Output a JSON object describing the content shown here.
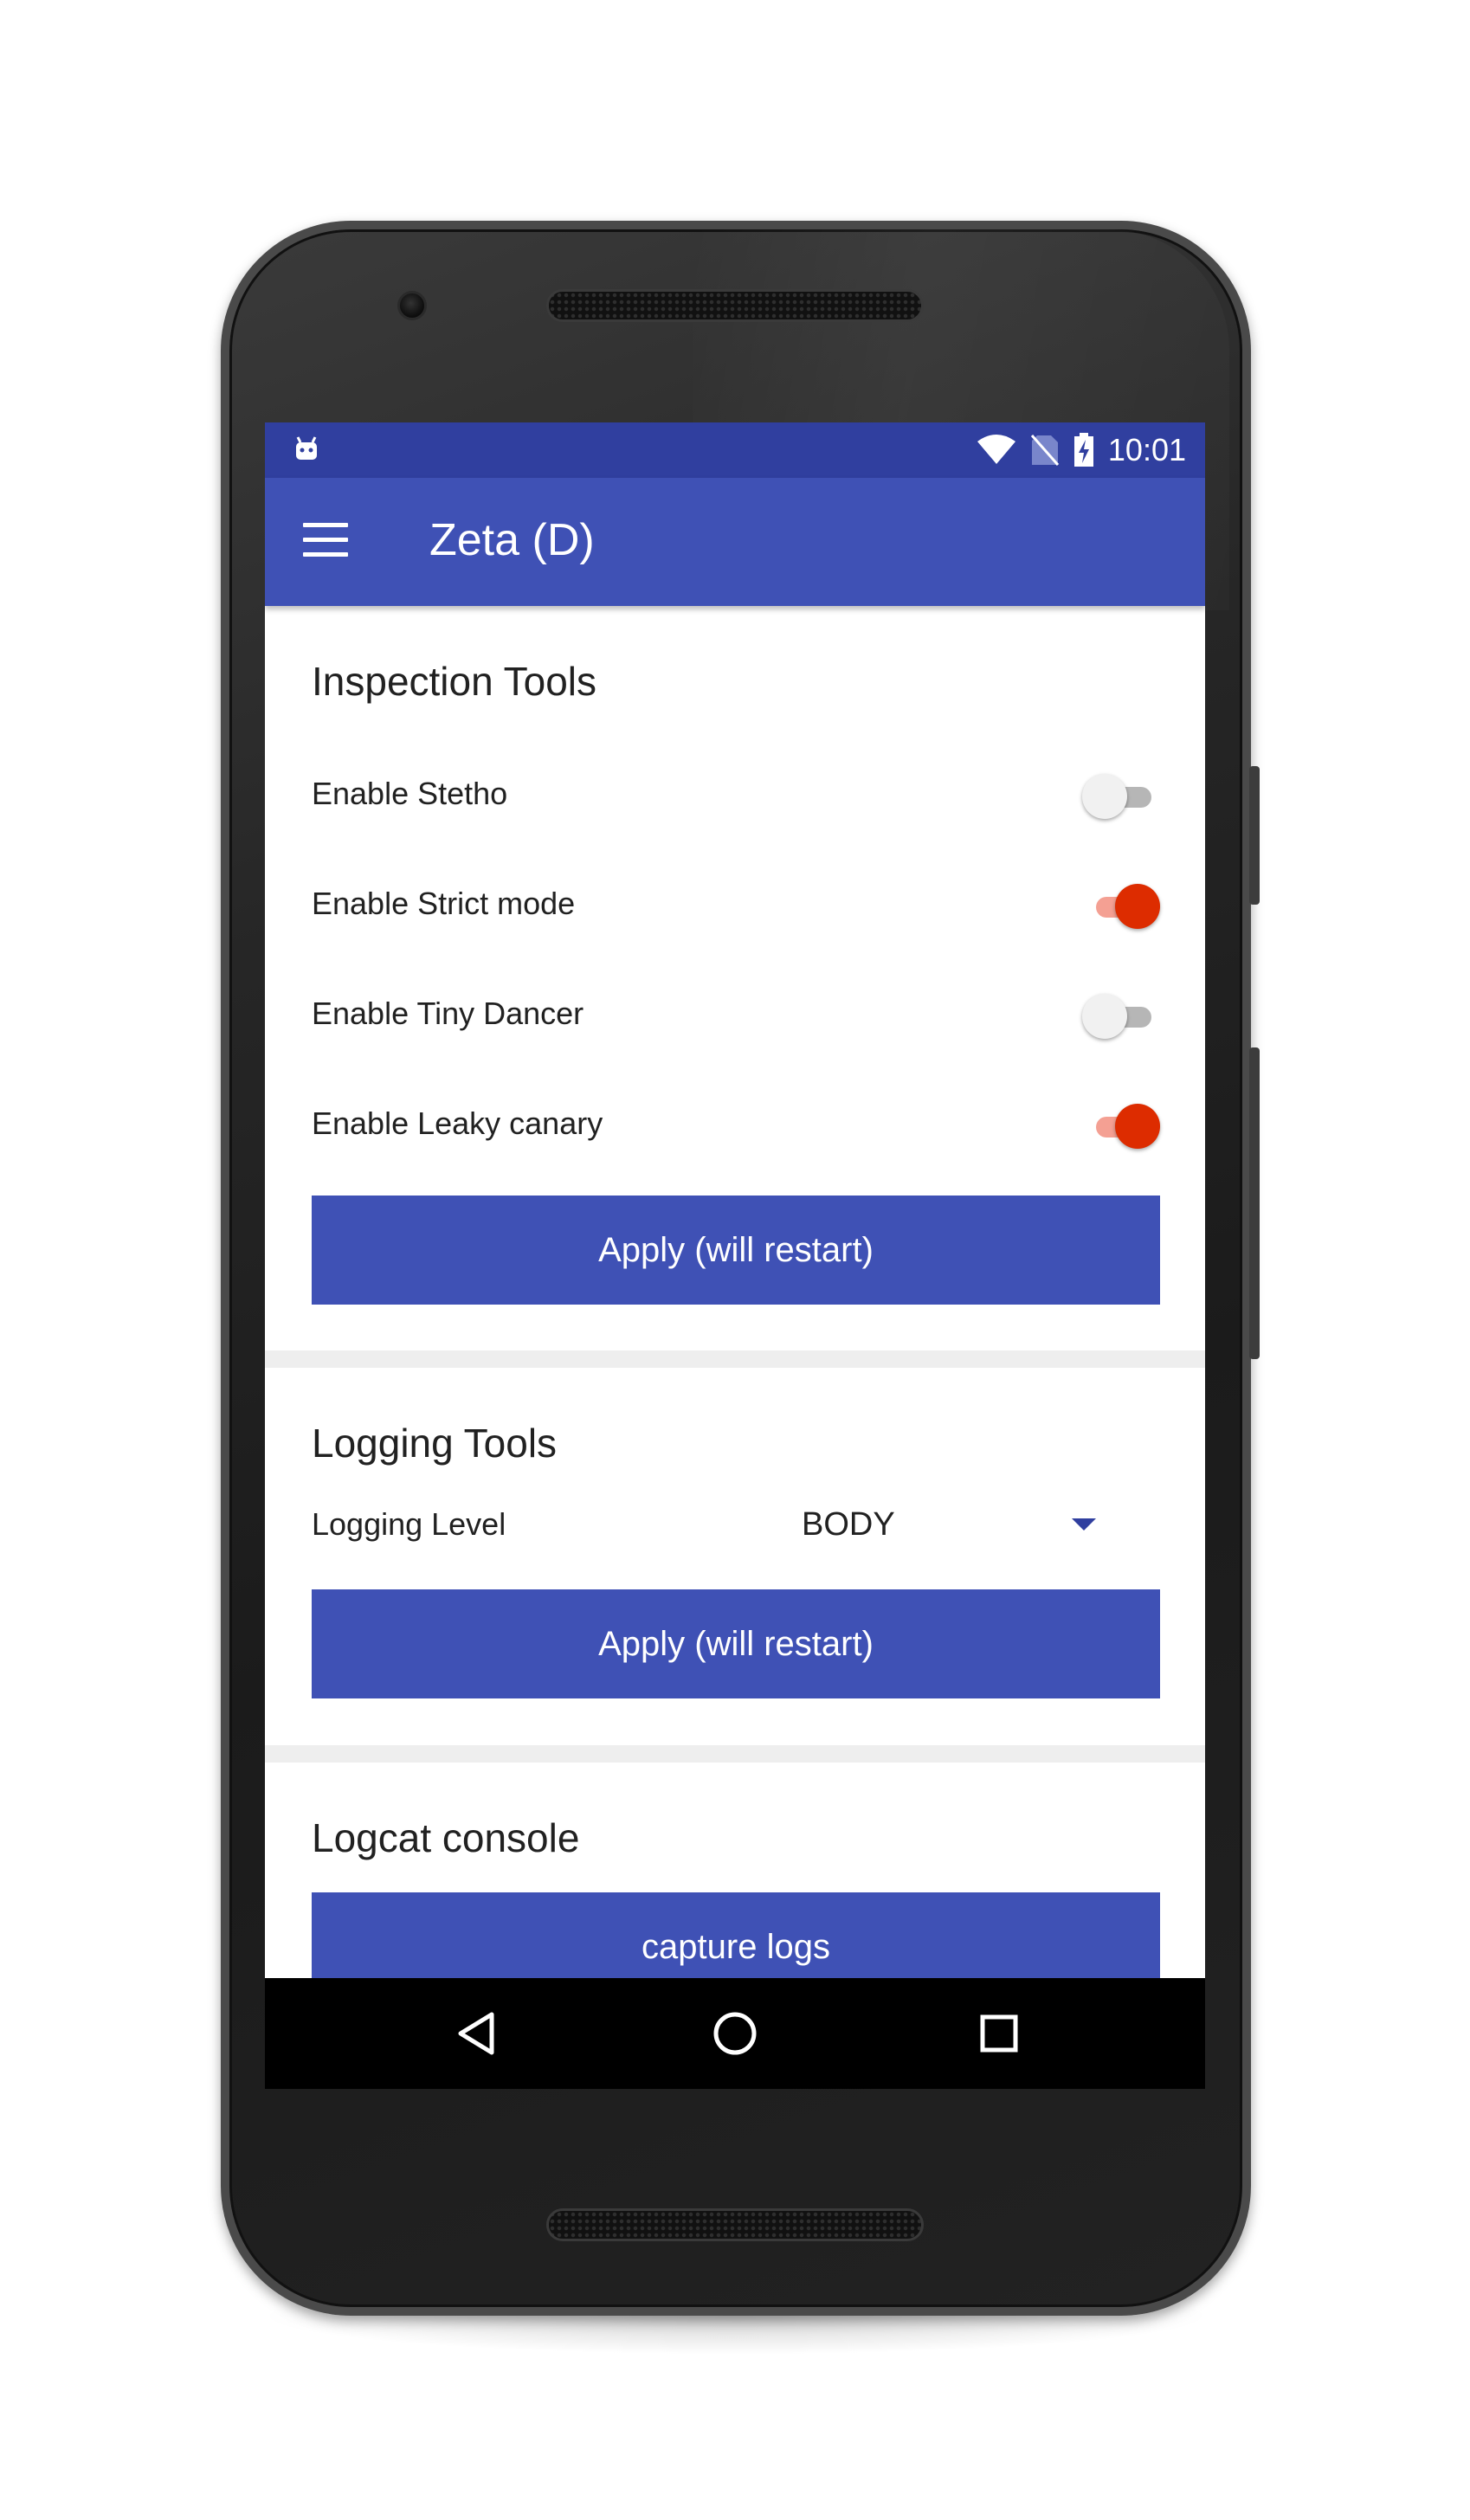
{
  "status_bar": {
    "time": "10:01",
    "icons": [
      "android-debug-icon",
      "wifi-icon",
      "no-sim-icon",
      "battery-charging-icon"
    ]
  },
  "app_bar": {
    "title": "Zeta (D)",
    "menu_icon": "hamburger-menu-icon"
  },
  "inspection_tools": {
    "title": "Inspection Tools",
    "toggles": [
      {
        "label": "Enable Stetho",
        "on": false
      },
      {
        "label": "Enable Strict mode",
        "on": true
      },
      {
        "label": "Enable Tiny Dancer",
        "on": false
      },
      {
        "label": "Enable Leaky canary",
        "on": true
      }
    ],
    "apply_label": "Apply (will restart)"
  },
  "logging_tools": {
    "title": "Logging Tools",
    "level_label": "Logging Level",
    "level_value": "BODY",
    "apply_label": "Apply (will restart)"
  },
  "logcat_console": {
    "title": "Logcat console",
    "capture_label": "capture logs"
  },
  "nav_bar": {
    "icons": [
      "back-icon",
      "home-icon",
      "recents-icon"
    ]
  },
  "colors": {
    "primary": "#3f51b5",
    "primary_dark": "#303f9f",
    "accent": "#dd2c00"
  }
}
